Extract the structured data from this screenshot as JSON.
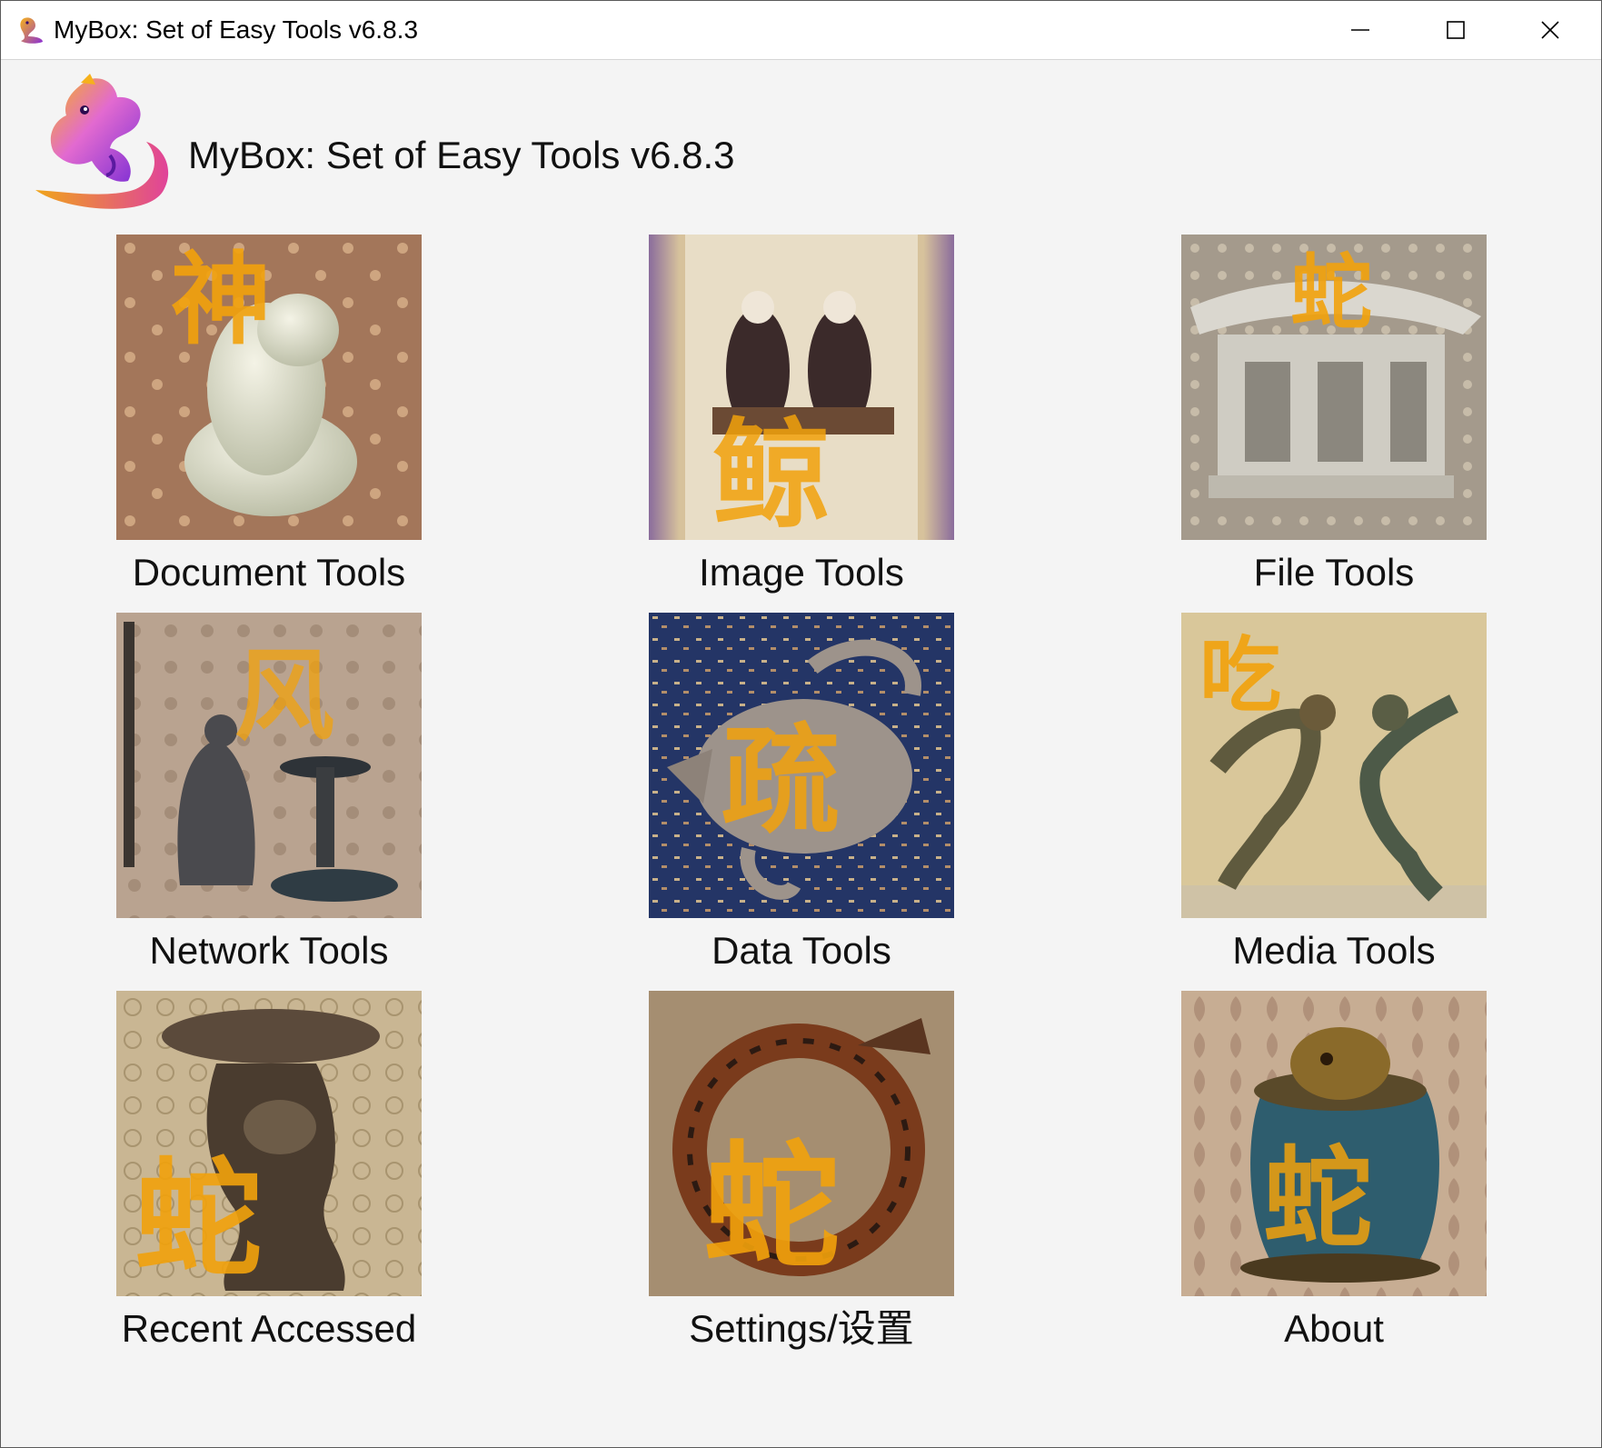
{
  "window": {
    "title": "MyBox: Set of Easy Tools v6.8.3",
    "minimize_icon": "minimize-icon",
    "maximize_icon": "maximize-icon",
    "close_icon": "close-icon"
  },
  "header": {
    "title": "MyBox: Set of Easy Tools v6.8.3",
    "logo_icon": "mybox-logo-icon"
  },
  "colors": {
    "titlebar": "#ffffff",
    "background": "#f4f4f4",
    "gold": "#f2a20c",
    "logo_purple": "#7a2fd1"
  },
  "tools": [
    {
      "label": "Document Tools",
      "icon": "document-tools-icon"
    },
    {
      "label": "Image Tools",
      "icon": "image-tools-icon"
    },
    {
      "label": "File Tools",
      "icon": "file-tools-icon"
    },
    {
      "label": "Network Tools",
      "icon": "network-tools-icon"
    },
    {
      "label": "Data Tools",
      "icon": "data-tools-icon"
    },
    {
      "label": "Media Tools",
      "icon": "media-tools-icon"
    },
    {
      "label": "Recent Accessed",
      "icon": "recent-accessed-icon"
    },
    {
      "label": "Settings/设置",
      "icon": "settings-icon"
    },
    {
      "label": "About",
      "icon": "about-icon"
    }
  ]
}
